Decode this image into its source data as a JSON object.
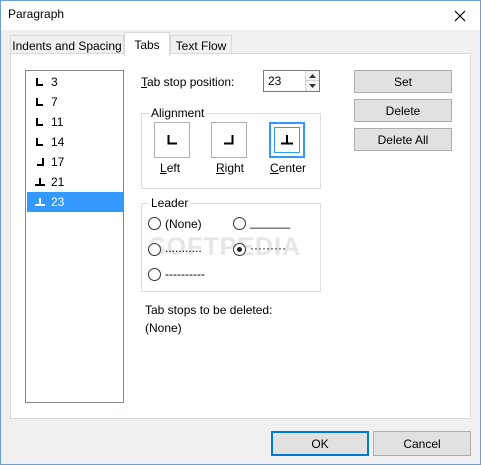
{
  "window": {
    "title": "Paragraph"
  },
  "tabs": [
    {
      "label": "Indents and Spacing"
    },
    {
      "label": "Tabs"
    },
    {
      "label": "Text Flow"
    }
  ],
  "tab_stops": [
    {
      "value": "3",
      "icon": "left-tab-icon"
    },
    {
      "value": "7",
      "icon": "left-tab-icon"
    },
    {
      "value": "11",
      "icon": "left-tab-icon"
    },
    {
      "value": "14",
      "icon": "left-tab-icon"
    },
    {
      "value": "17",
      "icon": "right-tab-icon"
    },
    {
      "value": "21",
      "icon": "center-tab-icon"
    },
    {
      "value": "23",
      "icon": "center-tab-icon",
      "selected": true
    }
  ],
  "position": {
    "label_prefix": "T",
    "label_rest": "ab stop position:",
    "value": "23"
  },
  "alignment": {
    "label": "Alignment",
    "options": [
      {
        "acc": "L",
        "rest": "eft"
      },
      {
        "acc": "R",
        "rest": "ight"
      },
      {
        "acc": "C",
        "rest": "enter",
        "selected": true
      }
    ]
  },
  "leader": {
    "label": "Leader",
    "options": {
      "none": "(None)",
      "underline": "______",
      "dots": "...........",
      "dot_dense": "·········",
      "dashes": "----------"
    },
    "selected": "dot_dense"
  },
  "to_delete": {
    "label": "Tab stops to be deleted:",
    "value": "(None)"
  },
  "buttons": {
    "set": "Set",
    "delete": "Delete",
    "delete_all": "Delete All",
    "ok": "OK",
    "cancel": "Cancel"
  },
  "watermark": "SOFTPEDIA"
}
